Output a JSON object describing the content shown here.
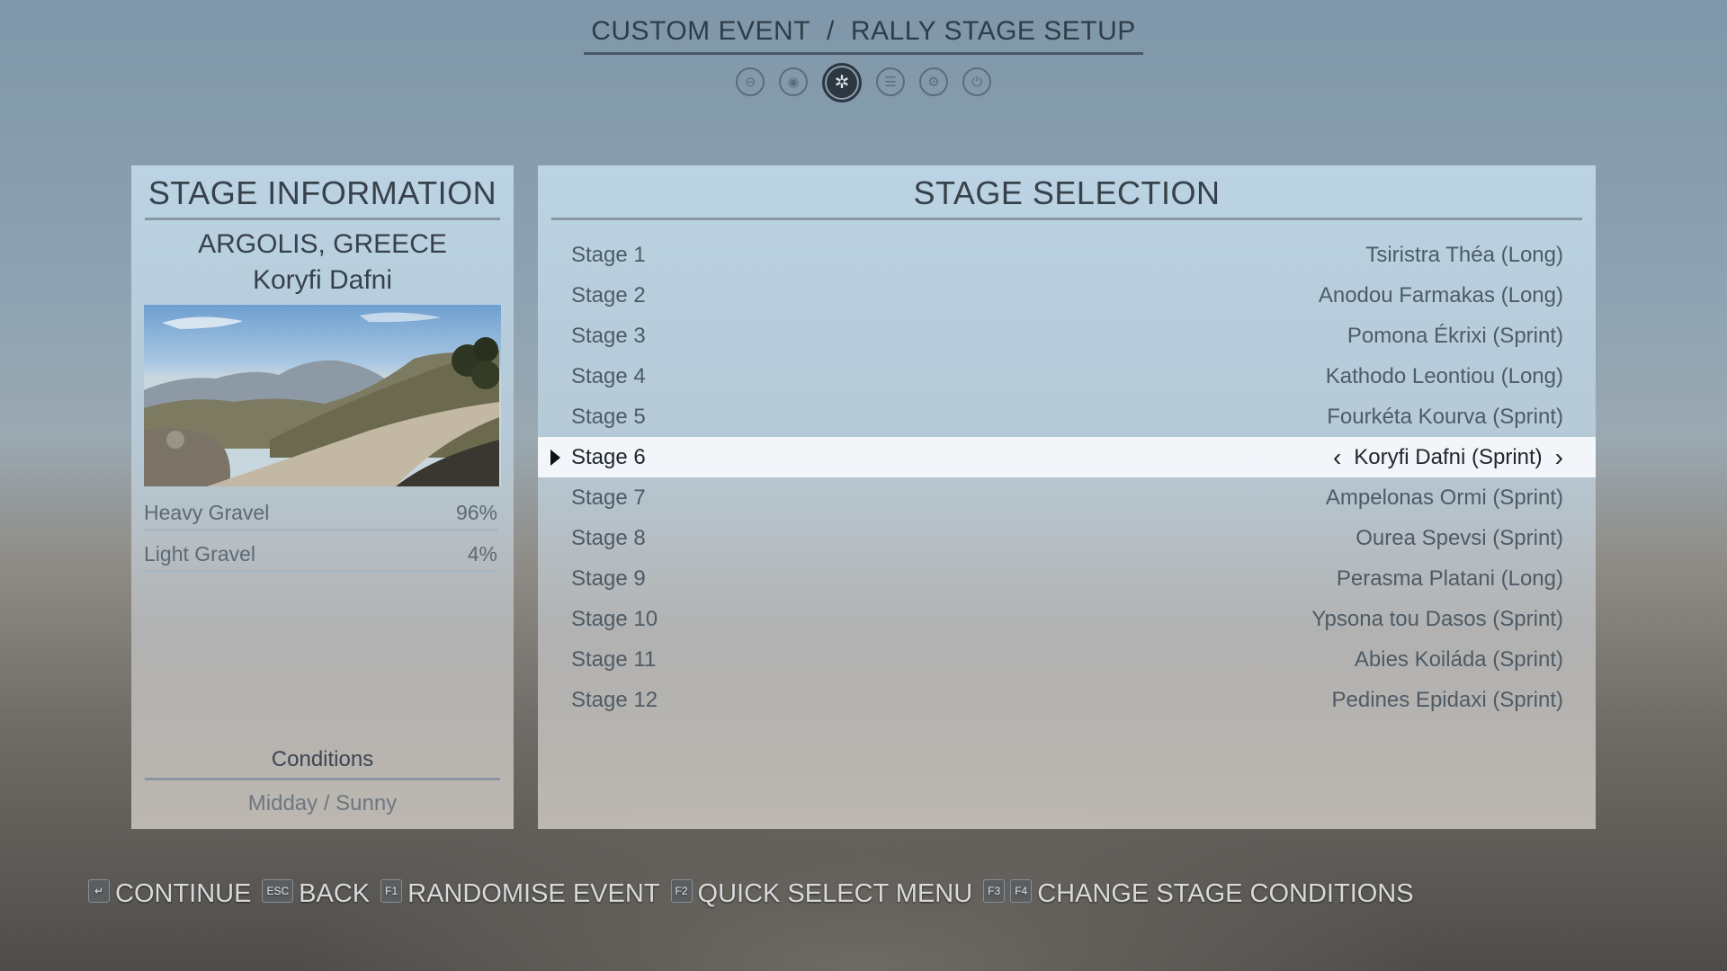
{
  "header": {
    "title_left": "CUSTOM EVENT",
    "title_separator": "/",
    "title_right": "RALLY STAGE SETUP",
    "tabs": [
      {
        "icon": "car-icon",
        "glyph": "⊖"
      },
      {
        "icon": "engine-icon",
        "glyph": "◉"
      },
      {
        "icon": "wheel-icon",
        "glyph": "✲"
      },
      {
        "icon": "notes-icon",
        "glyph": "☰"
      },
      {
        "icon": "tuning-icon",
        "glyph": "⚙"
      },
      {
        "icon": "power-icon",
        "glyph": "⏻"
      }
    ],
    "active_tab": 2
  },
  "stage_info": {
    "heading": "STAGE INFORMATION",
    "location": "ARGOLIS, GREECE",
    "stage_name": "Koryfi Dafni",
    "surfaces": [
      {
        "label": "Heavy Gravel",
        "value": "96%"
      },
      {
        "label": "Light Gravel",
        "value": "4%"
      }
    ],
    "conditions_label": "Conditions",
    "conditions_value": "Midday / Sunny"
  },
  "stage_selection": {
    "heading": "STAGE SELECTION",
    "selected_index": 5,
    "stages": [
      {
        "label": "Stage 1",
        "route": "Tsiristra Théa (Long)"
      },
      {
        "label": "Stage 2",
        "route": "Anodou Farmakas (Long)"
      },
      {
        "label": "Stage 3",
        "route": "Pomona Ékrixi (Sprint)"
      },
      {
        "label": "Stage 4",
        "route": "Kathodo Leontiou (Long)"
      },
      {
        "label": "Stage 5",
        "route": "Fourkéta Kourva (Sprint)"
      },
      {
        "label": "Stage 6",
        "route": "Koryfi Dafni (Sprint)"
      },
      {
        "label": "Stage 7",
        "route": "Ampelonas Ormi (Sprint)"
      },
      {
        "label": "Stage 8",
        "route": "Ourea Spevsi (Sprint)"
      },
      {
        "label": "Stage 9",
        "route": "Perasma Platani (Long)"
      },
      {
        "label": "Stage 10",
        "route": "Ypsona tou Dasos (Sprint)"
      },
      {
        "label": "Stage 11",
        "route": "Abies Koiláda (Sprint)"
      },
      {
        "label": "Stage 12",
        "route": "Pedines Epidaxi (Sprint)"
      }
    ]
  },
  "footer": {
    "prompts": [
      {
        "keys": [
          "↵"
        ],
        "label": "CONTINUE"
      },
      {
        "keys": [
          "Esc"
        ],
        "label": "BACK"
      },
      {
        "keys": [
          "F1"
        ],
        "label": "RANDOMISE EVENT"
      },
      {
        "keys": [
          "F2"
        ],
        "label": "QUICK SELECT MENU"
      },
      {
        "keys": [
          "F3",
          "F4"
        ],
        "label": "CHANGE STAGE CONDITIONS"
      }
    ]
  }
}
